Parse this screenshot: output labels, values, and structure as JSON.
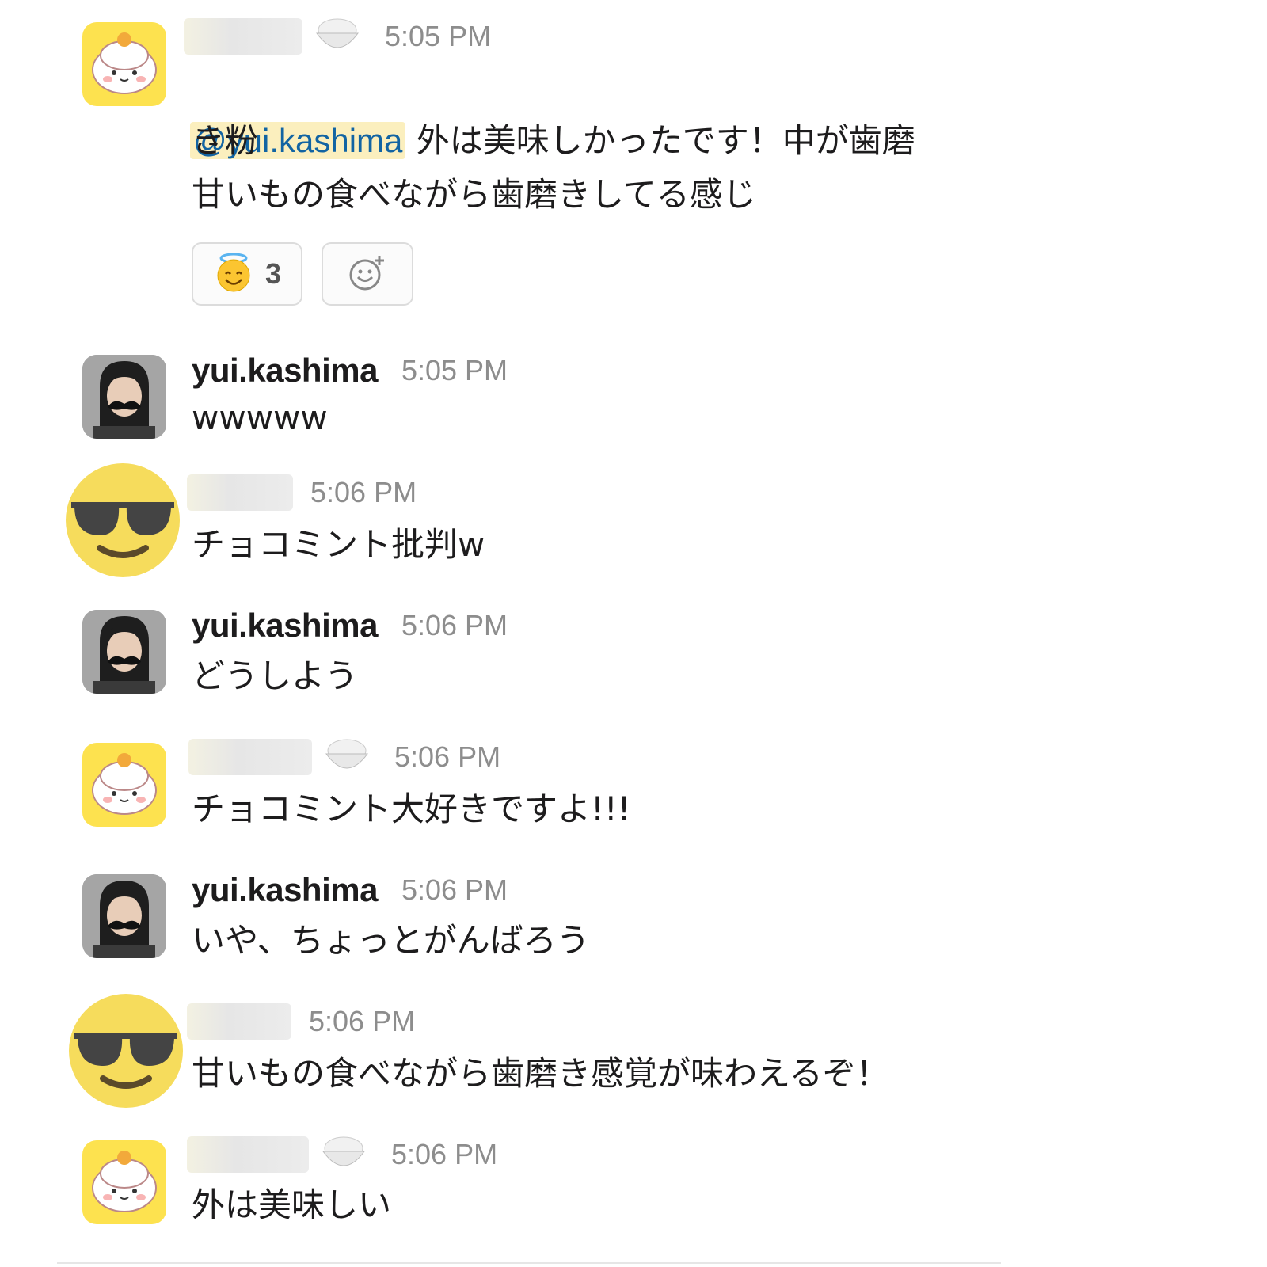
{
  "messages": [
    {
      "avatar": "rice-bowl-character-avatar",
      "name": "",
      "status_icon": "rice-bowl-icon",
      "time": "5:05 PM",
      "mention": "@yui.kashima",
      "text_after_mention": " 外は美味しかったです！中が歯磨",
      "text": "き粉\n甘いもの食べながら歯磨きしてる感じ",
      "reactions": [
        {
          "emoji": "smiling-face-with-halo",
          "count": "3"
        },
        {
          "emoji": "add-reaction"
        }
      ]
    },
    {
      "avatar": "user-photo-avatar",
      "name": "yui.kashima",
      "time": "5:05 PM",
      "text": "wwwww"
    },
    {
      "avatar": "sunglasses-emoji-avatar",
      "name": "",
      "time": "5:06 PM",
      "text": "チョコミント批判w"
    },
    {
      "avatar": "user-photo-avatar",
      "name": "yui.kashima",
      "time": "5:06 PM",
      "text": "どうしよう"
    },
    {
      "avatar": "rice-bowl-character-avatar",
      "name": "",
      "status_icon": "rice-bowl-icon",
      "time": "5:06 PM",
      "text": "チョコミント大好きですよ!!!"
    },
    {
      "avatar": "user-photo-avatar",
      "name": "yui.kashima",
      "time": "5:06 PM",
      "text": "いや、ちょっとがんばろう"
    },
    {
      "avatar": "sunglasses-emoji-avatar",
      "name": "",
      "time": "5:06 PM",
      "text": "甘いもの食べながら歯磨き感覚が味わえるぞ！"
    },
    {
      "avatar": "rice-bowl-character-avatar",
      "name": "",
      "status_icon": "rice-bowl-icon",
      "time": "5:06 PM",
      "text": "外は美味しい"
    }
  ]
}
